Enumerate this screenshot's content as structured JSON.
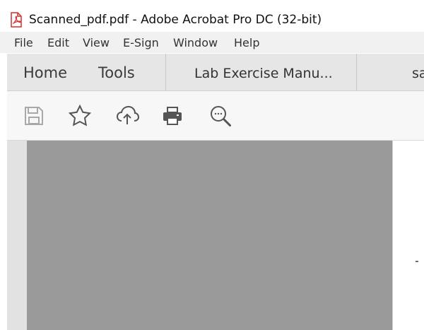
{
  "window": {
    "title": "Scanned_pdf.pdf - Adobe Acrobat Pro DC (32-bit)",
    "app_icon": "adobe-acrobat-icon"
  },
  "menu": {
    "items": [
      {
        "label": "File"
      },
      {
        "label": "Edit"
      },
      {
        "label": "View"
      },
      {
        "label": "E-Sign"
      },
      {
        "label": "Window"
      },
      {
        "label": "Help"
      }
    ]
  },
  "tabs": {
    "home": "Home",
    "tools": "Tools",
    "documents": [
      {
        "label": "Lab Exercise Manu..."
      },
      {
        "label": "sa"
      }
    ]
  },
  "toolbar": {
    "icons": [
      {
        "name": "save-icon"
      },
      {
        "name": "bookmark-star-icon"
      },
      {
        "name": "cloud-upload-icon"
      },
      {
        "name": "print-icon"
      },
      {
        "name": "search-zoom-icon"
      }
    ]
  },
  "colors": {
    "accent": "#d32f2f",
    "page_gray": "#9a9a9a"
  }
}
